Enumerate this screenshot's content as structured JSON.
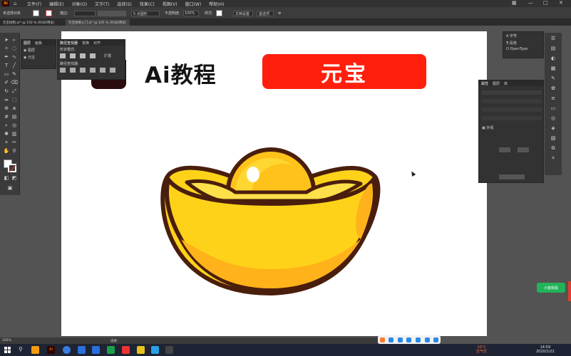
{
  "menubar": {
    "app_icon": "Ai",
    "items": [
      "文件(F)",
      "编辑(E)",
      "对象(O)",
      "文字(T)",
      "选择(S)",
      "效果(C)",
      "视图(V)",
      "窗口(W)",
      "帮助(H)"
    ]
  },
  "controlbar": {
    "selection_label": "未选择对象",
    "stroke_label": "描边:",
    "opacity_label": "不透明度:",
    "opacity_value": "100%",
    "style_label": "样式:",
    "doc_setup_button": "文档设置",
    "prefs_button": "首选项",
    "brush_label": "5 点圆形"
  },
  "tabbar": {
    "tabs": [
      "元宝绘制.ai* @ 150 % (RGB/预览)",
      "元宝绘制入门.ai* @ 105 % (RGB/预览)"
    ]
  },
  "pathfinder_panel": {
    "tabs": [
      "路径查找器",
      "变换",
      "对齐"
    ],
    "shape_modes_label": "形状模式:",
    "pathfinders_label": "路径查找器:",
    "expand_label": "扩展"
  },
  "layers_panel": {
    "tabs": [
      "图层",
      "画板"
    ],
    "items": [
      "图层",
      "元宝"
    ]
  },
  "character_panel": {
    "tabs": [
      "字符",
      "段落",
      "OpenType"
    ]
  },
  "properties_panel": {
    "tabs": [
      "属性",
      "图层",
      "库"
    ],
    "appearance_label": "外观"
  },
  "glyph_panel": {
    "items": [
      "字符",
      "段落",
      "OpenType"
    ]
  },
  "canvas": {
    "title": "Ai教程",
    "badge": "元宝"
  },
  "chip": {
    "label": "小窗观看"
  },
  "statusbar": {
    "zoom": "105%",
    "tool": "选择"
  },
  "taskbar": {
    "time": "14:59",
    "date": "2020/1/22",
    "weather": "10°C",
    "weather_note": "空气优"
  },
  "colors": {
    "badge_bg": "#ff1f0c",
    "ingot_gold": "#ffd21a",
    "ingot_outline": "#4a1e0c",
    "chip_green": "#22b35a"
  },
  "icons": [
    "home-icon",
    "selection-tool-icon",
    "direct-select-icon",
    "pen-tool-icon",
    "type-tool-icon",
    "line-tool-icon",
    "rectangle-tool-icon",
    "brush-tool-icon",
    "eraser-tool-icon",
    "rotate-tool-icon",
    "scale-tool-icon",
    "gradient-tool-icon",
    "eyedropper-icon",
    "zoom-icon",
    "hand-icon",
    "fill-swatch-icon",
    "stroke-swatch-icon",
    "windows-start-icon",
    "search-icon"
  ]
}
